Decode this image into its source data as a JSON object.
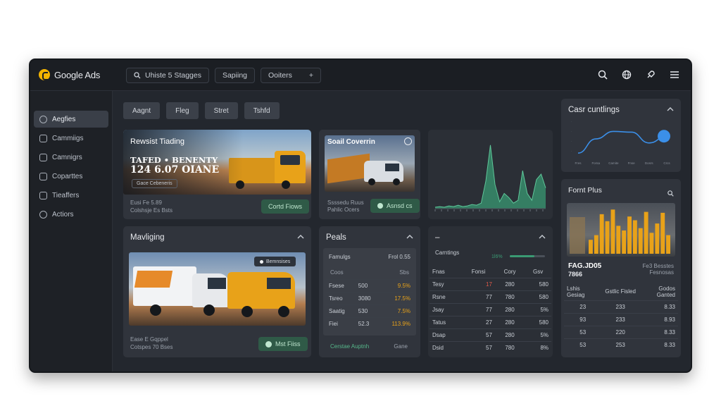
{
  "app": {
    "logo_text": "Google Ads",
    "top_search": "Uhiste 5 Stagges",
    "top_tab_2": "Sapiing",
    "top_tab_3": "Ooiters",
    "top_icons": [
      "search-icon",
      "globe-icon",
      "rocket-icon",
      "menu-icon"
    ]
  },
  "sidebar": {
    "items": [
      {
        "label": "Aegfies",
        "active": true
      },
      {
        "label": "Cammiigs"
      },
      {
        "label": "Camnigrs"
      },
      {
        "label": "Coparttes"
      },
      {
        "label": "Tieaffers"
      },
      {
        "label": "Actiors"
      }
    ]
  },
  "chips": [
    "Aagnt",
    "Fleg",
    "Stret",
    "Tshfd"
  ],
  "hero": {
    "title": "Rewsist Tiading",
    "headline_1": "TAFED • BENENTY",
    "headline_2": "124 6.07 OIANE",
    "tag": "Gace Cebeneris",
    "sub_1": "Eusi Fe 5.89",
    "sub_2": "Colshsje Es Bsts",
    "button": "Cortd Fiows"
  },
  "promo": {
    "title": "Soail Coverrin",
    "sub_1": "Ssssedu Ruus",
    "sub_2": "Pahlic Ocers",
    "button": "Asnsd cs"
  },
  "moving": {
    "title": "Mavliging",
    "badge": "Bemnsises",
    "sub_1": "Ease E Gqppel",
    "sub_2": "Cotspes 70 Bses",
    "button": "Mst Fiiss"
  },
  "pools": {
    "title": "Peals",
    "head_left": "Famulgs",
    "head_right": "Frol 0.55",
    "col_1": "Coos",
    "col_2": "Sbs",
    "rows": [
      {
        "name": "Fsese",
        "val": "500",
        "pct": "9.5%"
      },
      {
        "name": "Tsreo",
        "val": "3080",
        "pct": "17.5%"
      },
      {
        "name": "Saatig",
        "val": "530",
        "pct": "7.5%"
      },
      {
        "name": "Fiei",
        "val": "52.3",
        "pct": "113.9%"
      }
    ],
    "footer_left": "Cerstae Auptnh",
    "footer_right": "Gane"
  },
  "table_card": {
    "dash": "–",
    "head_label": "Carntings",
    "head_value": "1l6%",
    "columns": [
      "Fnas",
      "Fonsi",
      "Cory",
      "Gsv"
    ],
    "rows": [
      {
        "name": "Tesy",
        "a": "17",
        "b": "280",
        "c": "580"
      },
      {
        "name": "Rsne",
        "a": "77",
        "b": "780",
        "c": "580"
      },
      {
        "name": "Jsay",
        "a": "77",
        "b": "280",
        "c": "5%"
      },
      {
        "name": "Tatus",
        "a": "27",
        "b": "280",
        "c": "580"
      },
      {
        "name": "Dsap",
        "a": "57",
        "b": "280",
        "c": "5%"
      },
      {
        "name": "Dsid",
        "a": "57",
        "b": "780",
        "c": "8%"
      }
    ]
  },
  "cost_card": {
    "title": "Casr cuntlings",
    "x_ticks": [
      "Fres",
      "Forsa",
      "Camite",
      "Fnse",
      "Dosrs",
      "Crcs"
    ]
  },
  "front_card": {
    "title": "Fornt Plus",
    "big_1": "FAG.JD05",
    "big_2": "7866",
    "sub_1": "Fe3 Besstes",
    "sub_2": "Fesnosas",
    "columns": [
      "Lshis Gesiag",
      "Gstlic Fisled",
      "Godos Ganted"
    ],
    "rows": [
      {
        "a": "23",
        "b": "233",
        "c": "8.33"
      },
      {
        "a": "93",
        "b": "233",
        "c": "8.93"
      },
      {
        "a": "53",
        "b": "220",
        "c": "8.33"
      },
      {
        "a": "53",
        "b": "253",
        "c": "8.33"
      }
    ]
  },
  "colors": {
    "accent_green": "#3a9a73",
    "accent_orange": "#e8a219",
    "line_blue": "#3b8fe8"
  },
  "chart_data": [
    {
      "type": "area",
      "series": [
        {
          "values": [
            2,
            3,
            2,
            4,
            3,
            5,
            3,
            4,
            6,
            5,
            8,
            40,
            92,
            35,
            10,
            22,
            16,
            8,
            12,
            55,
            22,
            12,
            42,
            50,
            30
          ]
        }
      ],
      "ylim": [
        0,
        100
      ],
      "title": "",
      "xlabel": "",
      "ylabel": ""
    },
    {
      "type": "line",
      "categories": [
        "Fres",
        "Forsa",
        "Camite",
        "Fnse",
        "Dosrs",
        "Crcs"
      ],
      "series": [
        {
          "values": [
            10,
            52,
            74,
            72,
            40,
            60
          ]
        }
      ],
      "ylim": [
        0,
        100
      ],
      "title": "Casr cuntlings",
      "xlabel": "",
      "ylabel": ""
    },
    {
      "type": "bar",
      "series": [
        {
          "values": [
            30,
            40,
            85,
            70,
            95,
            60,
            50,
            80,
            72,
            55,
            90,
            45,
            65,
            88,
            40
          ]
        }
      ],
      "ylim": [
        0,
        100
      ],
      "title": "Fornt Plus",
      "xlabel": "",
      "ylabel": ""
    }
  ]
}
